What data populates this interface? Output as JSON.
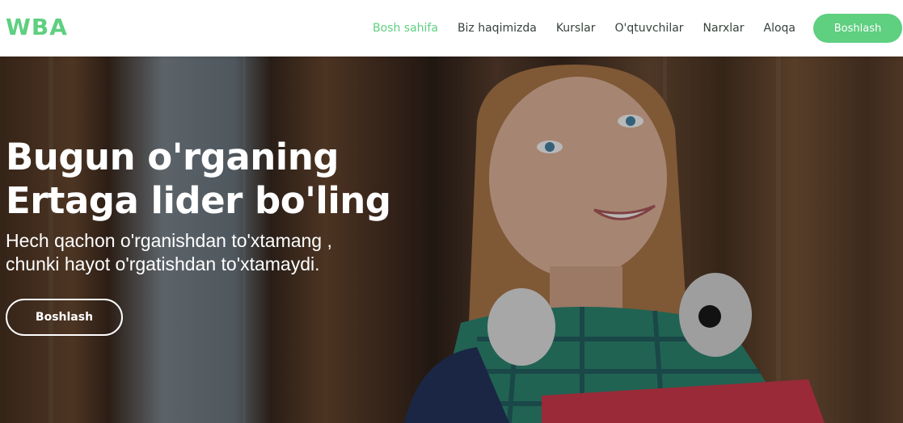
{
  "brand": {
    "name": "WBA"
  },
  "nav": {
    "items": [
      {
        "label": "Bosh sahifa",
        "active": true
      },
      {
        "label": "Biz haqimizda",
        "active": false
      },
      {
        "label": "Kurslar",
        "active": false
      },
      {
        "label": "O'qtuvchilar",
        "active": false
      },
      {
        "label": "Narxlar",
        "active": false
      },
      {
        "label": "Aloqa",
        "active": false
      }
    ],
    "cta_label": "Boshlash"
  },
  "hero": {
    "title_line1": "Bugun o'rganing",
    "title_line2": "Ertaga lider bo'ling",
    "subtitle_line1": "Hech qachon o'rganishdan to'xtamang ,",
    "subtitle_line2": "chunki hayot o'rgatishdan to'xtamaydi.",
    "button_label": "Boshlash"
  },
  "colors": {
    "accent": "#5fcf80",
    "nav_text": "#37423b",
    "hero_text": "#ffffff"
  }
}
